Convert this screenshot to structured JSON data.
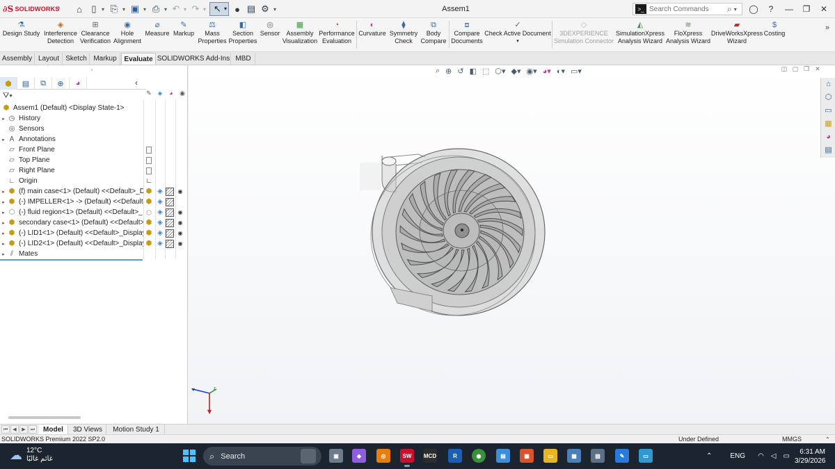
{
  "titlebar": {
    "app_name": "SOLIDWORKS",
    "document_title": "Assem1",
    "search_placeholder": "Search Commands"
  },
  "ribbon": {
    "buttons": [
      {
        "l1": "Design Study",
        "l2": ""
      },
      {
        "l1": "Interference",
        "l2": "Detection"
      },
      {
        "l1": "Clearance",
        "l2": "Verification"
      },
      {
        "l1": "Hole",
        "l2": "Alignment"
      },
      {
        "l1": "Measure",
        "l2": ""
      },
      {
        "l1": "Markup",
        "l2": ""
      },
      {
        "l1": "Mass",
        "l2": "Properties"
      },
      {
        "l1": "Section",
        "l2": "Properties"
      },
      {
        "l1": "Sensor",
        "l2": ""
      },
      {
        "l1": "Assembly",
        "l2": "Visualization"
      },
      {
        "l1": "Performance",
        "l2": "Evaluation"
      },
      {
        "l1": "Curvature",
        "l2": ""
      },
      {
        "l1": "Symmetry",
        "l2": "Check"
      },
      {
        "l1": "Body",
        "l2": "Compare"
      },
      {
        "l1": "Compare",
        "l2": "Documents"
      },
      {
        "l1": "Check Active Document",
        "l2": ""
      },
      {
        "l1": "3DEXPERIENCE",
        "l2": "Simulation Connector"
      },
      {
        "l1": "SimulationXpress",
        "l2": "Analysis Wizard"
      },
      {
        "l1": "FloXpress",
        "l2": "Analysis Wizard"
      },
      {
        "l1": "DriveWorksXpress",
        "l2": "Wizard"
      },
      {
        "l1": "Costing",
        "l2": ""
      }
    ]
  },
  "tabs": [
    "Assembly",
    "Layout",
    "Sketch",
    "Markup",
    "Evaluate",
    "SOLIDWORKS Add-Ins",
    "MBD"
  ],
  "active_tab": "Evaluate",
  "tree": {
    "root": "Assem1 (Default) <Display State-1>",
    "items": [
      {
        "label": "History",
        "icon": "history-icon"
      },
      {
        "label": "Sensors",
        "icon": "sensor-icon"
      },
      {
        "label": "Annotations",
        "icon": "annotation-icon"
      },
      {
        "label": "Front Plane",
        "icon": "plane-icon"
      },
      {
        "label": "Top Plane",
        "icon": "plane-icon"
      },
      {
        "label": "Right Plane",
        "icon": "plane-icon"
      },
      {
        "label": "Origin",
        "icon": "origin-icon"
      },
      {
        "label": "(f) main case<1> (Default) <<Default>_Di",
        "icon": "part-icon"
      },
      {
        "label": "(-) IMPELLER<1> -> (Default) <<Default>",
        "icon": "part-icon"
      },
      {
        "label": "(-) fluid region<1> (Default) <<Default>_",
        "icon": "part-icon"
      },
      {
        "label": "secondary case<1> (Default) <<Default>_",
        "icon": "part-icon"
      },
      {
        "label": "(-) LID1<1> (Default) <<Default>_Display",
        "icon": "part-icon"
      },
      {
        "label": "(-) LID2<1> (Default) <<Default>_Display",
        "icon": "part-icon"
      },
      {
        "label": "Mates",
        "icon": "mates-icon"
      }
    ]
  },
  "bottom_tabs": [
    "Model",
    "3D Views",
    "Motion Study 1"
  ],
  "status": {
    "product": "SOLIDWORKS Premium 2022 SP2.0",
    "state": "Under Defined",
    "units": "MMGS"
  },
  "taskbar": {
    "temperature": "12°C",
    "weather_text": "غائم غالبًا",
    "search_label": "Search",
    "apps": [
      "Task View",
      "Copilot",
      "Blender",
      "SOLIDWORKS 2022",
      "MCD",
      "Revit",
      "Chrome",
      "Notepad",
      "SolidWorks Data",
      "File Explorer",
      "Calculator",
      "Photos",
      "Paint",
      "Remote Desktop"
    ],
    "lang": "ENG",
    "time": "6:31 AM",
    "date": "3/29/2026"
  },
  "colors": {
    "accent": "#5d9dd5",
    "brand": "#c8102e",
    "taskbar": "#1c2430",
    "part_icon": "#c79a13"
  }
}
